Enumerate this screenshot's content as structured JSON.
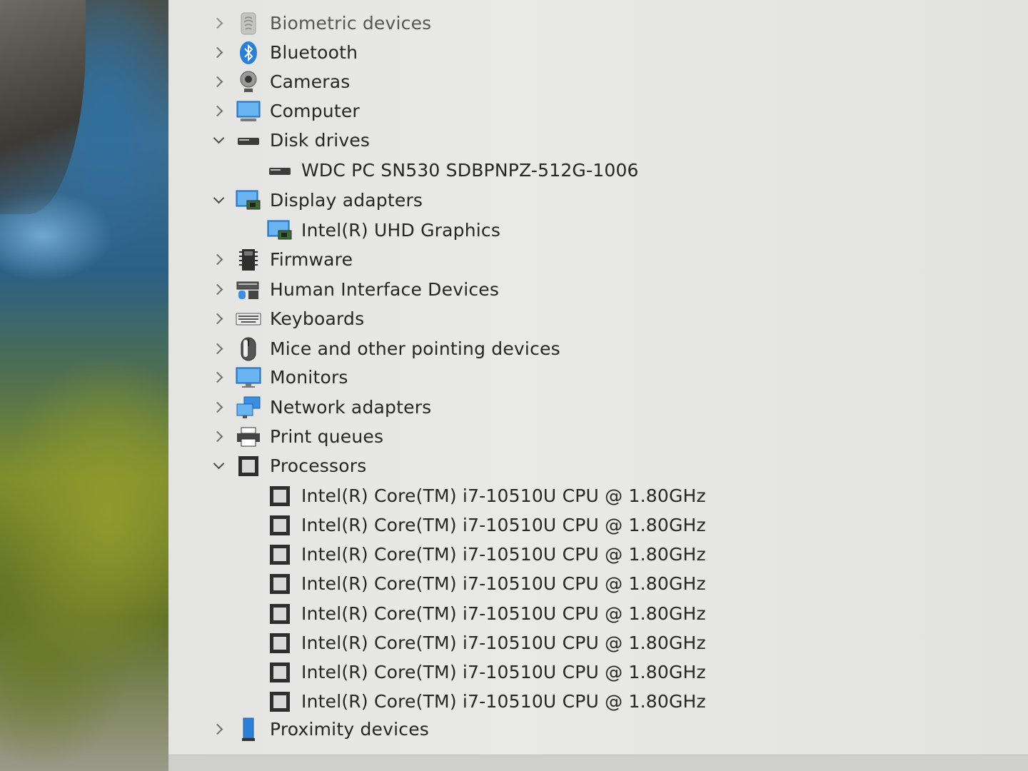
{
  "device_tree": {
    "categories": [
      {
        "label": "Biometric devices",
        "icon": "fingerprint-icon",
        "state": "collapsed"
      },
      {
        "label": "Bluetooth",
        "icon": "bluetooth-icon",
        "state": "collapsed"
      },
      {
        "label": "Cameras",
        "icon": "camera-icon",
        "state": "collapsed"
      },
      {
        "label": "Computer",
        "icon": "computer-icon",
        "state": "collapsed"
      },
      {
        "label": "Disk drives",
        "icon": "disk-drive-icon",
        "state": "expanded",
        "children": [
          "WDC PC SN530 SDBPNPZ-512G-1006"
        ]
      },
      {
        "label": "Display adapters",
        "icon": "display-adapter-icon",
        "state": "expanded",
        "children": [
          "Intel(R) UHD Graphics"
        ]
      },
      {
        "label": "Firmware",
        "icon": "firmware-icon",
        "state": "collapsed"
      },
      {
        "label": "Human Interface Devices",
        "icon": "hid-icon",
        "state": "collapsed"
      },
      {
        "label": "Keyboards",
        "icon": "keyboard-icon",
        "state": "collapsed"
      },
      {
        "label": "Mice and other pointing devices",
        "icon": "mouse-icon",
        "state": "collapsed"
      },
      {
        "label": "Monitors",
        "icon": "monitor-icon",
        "state": "collapsed"
      },
      {
        "label": "Network adapters",
        "icon": "network-adapter-icon",
        "state": "collapsed"
      },
      {
        "label": "Print queues",
        "icon": "printer-icon",
        "state": "collapsed"
      },
      {
        "label": "Processors",
        "icon": "processor-icon",
        "state": "expanded",
        "children": [
          "Intel(R) Core(TM) i7-10510U CPU @ 1.80GHz",
          "Intel(R) Core(TM) i7-10510U CPU @ 1.80GHz",
          "Intel(R) Core(TM) i7-10510U CPU @ 1.80GHz",
          "Intel(R) Core(TM) i7-10510U CPU @ 1.80GHz",
          "Intel(R) Core(TM) i7-10510U CPU @ 1.80GHz",
          "Intel(R) Core(TM) i7-10510U CPU @ 1.80GHz",
          "Intel(R) Core(TM) i7-10510U CPU @ 1.80GHz",
          "Intel(R) Core(TM) i7-10510U CPU @ 1.80GHz"
        ]
      },
      {
        "label": "Proximity devices",
        "icon": "proximity-device-icon",
        "state": "collapsed"
      }
    ]
  },
  "colors": {
    "text": "#262626",
    "accent_blue": "#2b7fd6",
    "chevron": "#6f6f6f"
  }
}
